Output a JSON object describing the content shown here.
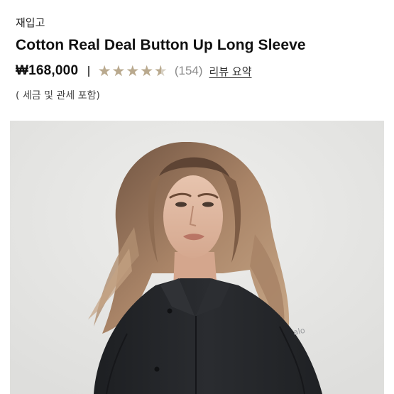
{
  "product": {
    "badge": "재입고",
    "title": "Cotton Real Deal Button Up Long Sleeve",
    "price": "₩168,000",
    "rating": {
      "value": 4.5,
      "stars_display": "★★★★★",
      "count": "(154)",
      "summary_link": "리뷰 요약"
    },
    "tax_note": "( 세금 및 관세 포함)"
  },
  "hero_image": {
    "logo_text": "alo"
  },
  "colors": {
    "star_filled": "#b9a98e",
    "star_empty": "#d6cfc2",
    "image_background": "#e6e6e4",
    "shirt": "#24262a"
  }
}
